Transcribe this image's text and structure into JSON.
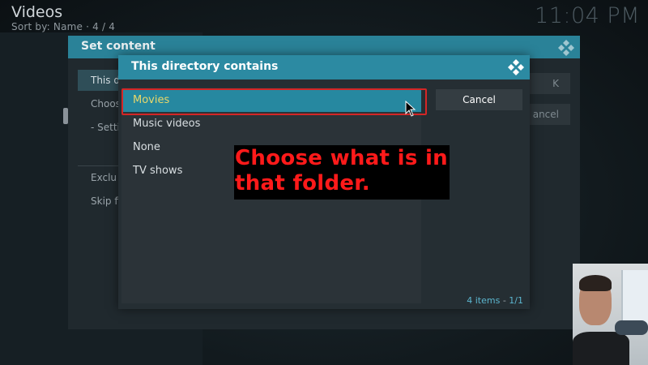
{
  "header": {
    "title": "Videos",
    "sort": "Sort by: Name  ·  4 / 4"
  },
  "clock": "11:04 PM",
  "outer_dialog": {
    "title": "Set content",
    "items": [
      "This d",
      "Choos",
      "- Settin",
      "Exclu",
      "Skip fi"
    ],
    "buttons": [
      "K",
      "ancel"
    ]
  },
  "inner_dialog": {
    "title": "This directory contains",
    "items": [
      "Movies",
      "Music videos",
      "None",
      "TV shows"
    ],
    "selected": "Movies",
    "cancel_label": "Cancel",
    "count_items": "4 items",
    "count_sep": " - ",
    "count_page": "1/1"
  },
  "annotation": {
    "line1": "Choose what is in",
    "line2": "that folder."
  },
  "colors": {
    "accent": "#2c8aa2",
    "focused_text": "#e9d76a",
    "annotation_text": "#ff1a1a",
    "highlight_border": "#d42626"
  },
  "icons": {
    "kodi_logo": "kodi-logo-icon",
    "cursor": "mouse-pointer-icon"
  }
}
